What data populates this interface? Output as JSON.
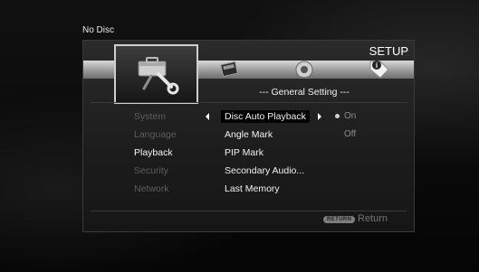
{
  "status": {
    "disc": "No Disc"
  },
  "header": {
    "title": "SETUP"
  },
  "tabs": [
    {
      "icon": "toolbox-wrench-icon",
      "active": true
    },
    {
      "icon": "film-clapper-icon",
      "active": false
    },
    {
      "icon": "speaker-icon",
      "active": false
    },
    {
      "icon": "info-tag-icon",
      "active": false
    }
  ],
  "section": {
    "title": "--- General Setting ---"
  },
  "categories": [
    {
      "label": "System",
      "current": false
    },
    {
      "label": "Language",
      "current": false
    },
    {
      "label": "Playback",
      "current": true
    },
    {
      "label": "Security",
      "current": false
    },
    {
      "label": "Network",
      "current": false
    }
  ],
  "items": [
    {
      "label": "Disc Auto Playback",
      "selected": true
    },
    {
      "label": "Angle Mark",
      "selected": false
    },
    {
      "label": "PIP Mark",
      "selected": false
    },
    {
      "label": "Secondary Audio...",
      "selected": false
    },
    {
      "label": "Last Memory",
      "selected": false
    }
  ],
  "values": [
    {
      "label": "On",
      "active": true
    },
    {
      "label": "Off",
      "active": false
    }
  ],
  "footer": {
    "return_key": "RETURN",
    "return_label": "Return"
  },
  "colors": {
    "tab_band": "#b0b0b0",
    "panel": "#222222",
    "inactive_text": "#5d5d5d"
  }
}
